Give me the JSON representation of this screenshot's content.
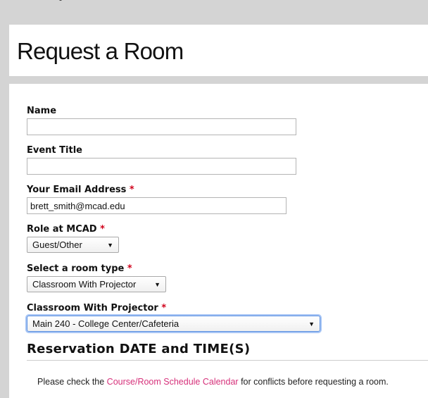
{
  "page": {
    "title": "Request a Room"
  },
  "form": {
    "name": {
      "label": "Name",
      "value": ""
    },
    "event_title": {
      "label": "Event Title",
      "value": ""
    },
    "email": {
      "label": "Your Email Address",
      "required_mark": "*",
      "value": "brett_smith@mcad.edu"
    },
    "role": {
      "label": "Role at MCAD",
      "required_mark": "*",
      "selected": "Guest/Other"
    },
    "room_type": {
      "label": "Select a room type",
      "required_mark": "*",
      "selected": "Classroom With Projector"
    },
    "classroom": {
      "label": "Classroom With Projector",
      "required_mark": "*",
      "selected": "Main 240 - College Center/Cafeteria"
    }
  },
  "reservation": {
    "heading": "Reservation DATE and TIME(S)",
    "notice_prefix": "Please check the ",
    "notice_link": "Course/Room Schedule Calendar",
    "notice_suffix": " for conflicts before requesting a room."
  },
  "icons": {
    "select_arrow": "▼"
  },
  "colors": {
    "required": "#d0021b",
    "link": "#d6307a",
    "focus_ring": "#a8c6f5"
  }
}
